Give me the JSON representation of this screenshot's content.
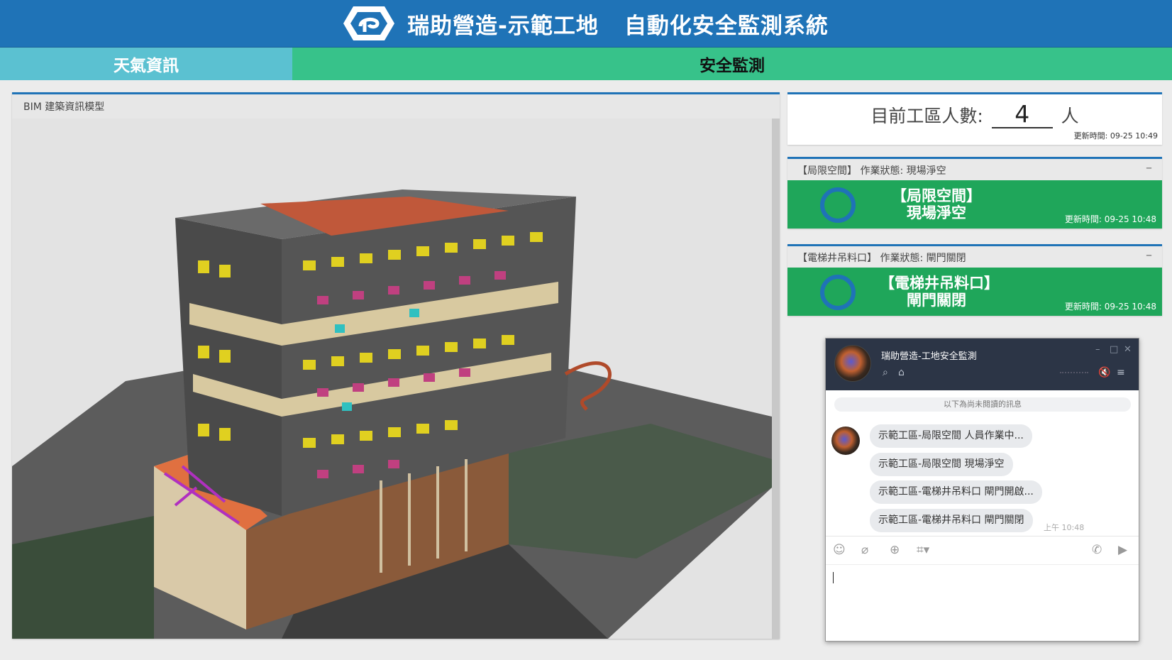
{
  "header": {
    "title_left": "瑞助營造-示範工地",
    "title_right": "自動化安全監測系統"
  },
  "tabs": [
    {
      "label": "天氣資訊"
    },
    {
      "label": "安全監測"
    }
  ],
  "bim": {
    "title": "BIM 建築資訊模型"
  },
  "headcount": {
    "label": "目前工區人數:",
    "value": "4",
    "unit": "人",
    "updated": "更新時間: 09-25 10:49"
  },
  "cards": [
    {
      "head": "【局限空間】  作業狀態: 現場淨空",
      "title_line1": "【局限空間】",
      "title_line2": "現場淨空",
      "updated": "更新時間: 09-25 10:48",
      "color": "#1fa65a"
    },
    {
      "head": "【電梯井吊料口】  作業狀態: 閘門關閉",
      "title_line1": "【電梯井吊料口】",
      "title_line2": "閘門關閉",
      "updated": "更新時間: 09-25 10:48",
      "color": "#1fa65a"
    }
  ],
  "chat": {
    "title": "瑞助營造-工地安全監測",
    "unread_notice": "以下為尚未閱讀的訊息",
    "messages": [
      "示範工區-局限空間 人員作業中...",
      "示範工區-局限空間 現場淨空",
      "示範工區-電梯井吊料口 閘門開啟...",
      "示範工區-電梯井吊料口 閘門關閉"
    ],
    "timestamp": "上午 10:48"
  }
}
